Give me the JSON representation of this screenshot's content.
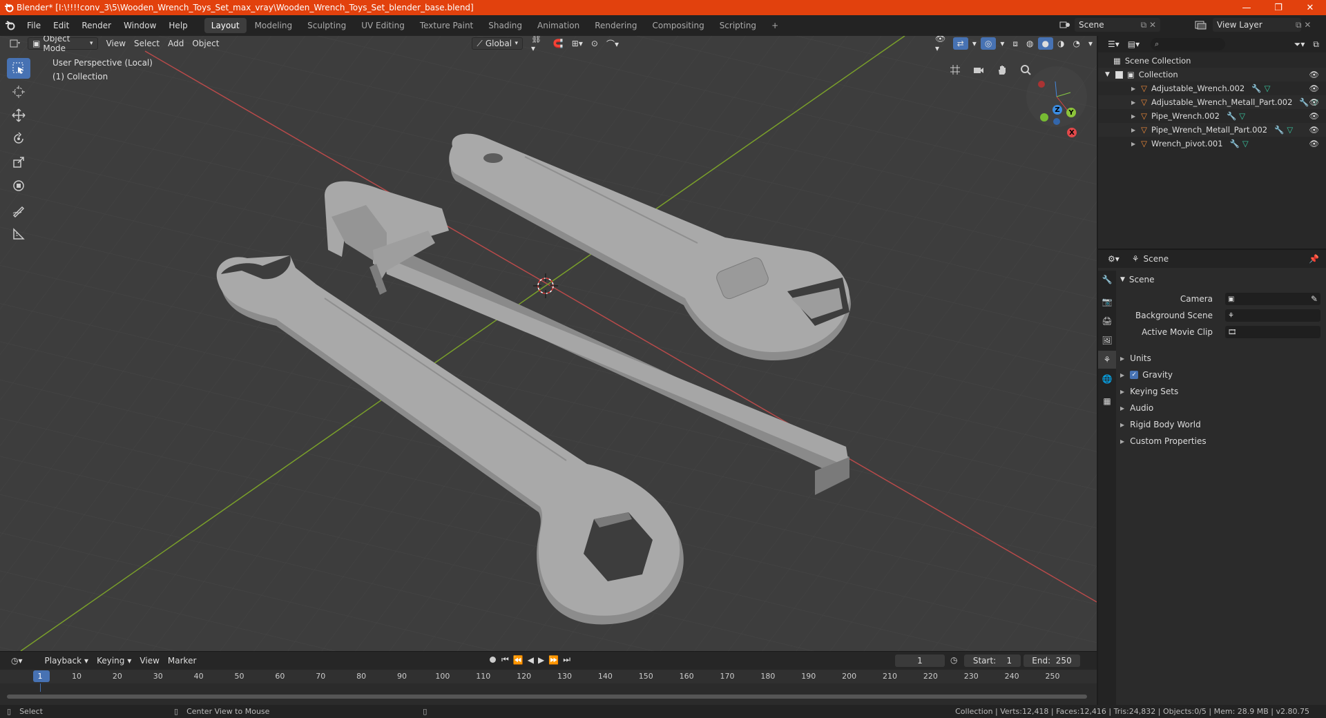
{
  "window": {
    "title": "Blender* [I:\\!!!!conv_3\\5\\Wooden_Wrench_Toys_Set_max_vray\\Wooden_Wrench_Toys_Set_blender_base.blend]",
    "minimize": "—",
    "maximize": "❐",
    "close": "✕"
  },
  "menu": {
    "items": [
      "File",
      "Edit",
      "Render",
      "Window",
      "Help"
    ],
    "workspaces": [
      "Layout",
      "Modeling",
      "Sculpting",
      "UV Editing",
      "Texture Paint",
      "Shading",
      "Animation",
      "Rendering",
      "Compositing",
      "Scripting"
    ],
    "add_tab": "+",
    "active_workspace": 0,
    "scene": "Scene",
    "view_layer": "View Layer"
  },
  "viewport": {
    "mode": "Object Mode",
    "menus": [
      "View",
      "Select",
      "Add",
      "Object"
    ],
    "orientation": "Global",
    "perspective": "User Perspective (Local)",
    "collection": "(1) Collection",
    "gizmo": {
      "x": "X",
      "y": "Y",
      "z": "Z"
    }
  },
  "timeline": {
    "menus": [
      "Playback",
      "Keying",
      "View",
      "Marker"
    ],
    "current_frame": "1",
    "start_label": "Start:",
    "start": "1",
    "end_label": "End:",
    "end": "250",
    "ticks": [
      "1",
      "10",
      "20",
      "30",
      "40",
      "50",
      "60",
      "70",
      "80",
      "90",
      "100",
      "110",
      "120",
      "130",
      "140",
      "150",
      "160",
      "170",
      "180",
      "190",
      "200",
      "210",
      "220",
      "230",
      "240",
      "250"
    ]
  },
  "statusbar": {
    "select": "Select",
    "center_view": "Center View to Mouse",
    "stats": "Collection | Verts:12,418 | Faces:12,416 | Tris:24,832 | Objects:0/5 | Mem: 28.9 MB | v2.80.75"
  },
  "outliner": {
    "root": "Scene Collection",
    "collection": "Collection",
    "objects": [
      "Adjustable_Wrench.002",
      "Adjustable_Wrench_Metall_Part.002",
      "Pipe_Wrench.002",
      "Pipe_Wrench_Metall_Part.002",
      "Wrench_pivot.001"
    ]
  },
  "properties": {
    "context": "Scene",
    "panel": "Scene",
    "camera_label": "Camera",
    "background_label": "Background Scene",
    "movieclip_label": "Active Movie Clip",
    "sections": [
      "Units",
      "Gravity",
      "Keying Sets",
      "Audio",
      "Rigid Body World",
      "Custom Properties"
    ]
  },
  "colors": {
    "accent": "#4772b3",
    "titlebar": "#e2410d",
    "object": "#ee8a3a",
    "mesh": "#39c6a0"
  }
}
